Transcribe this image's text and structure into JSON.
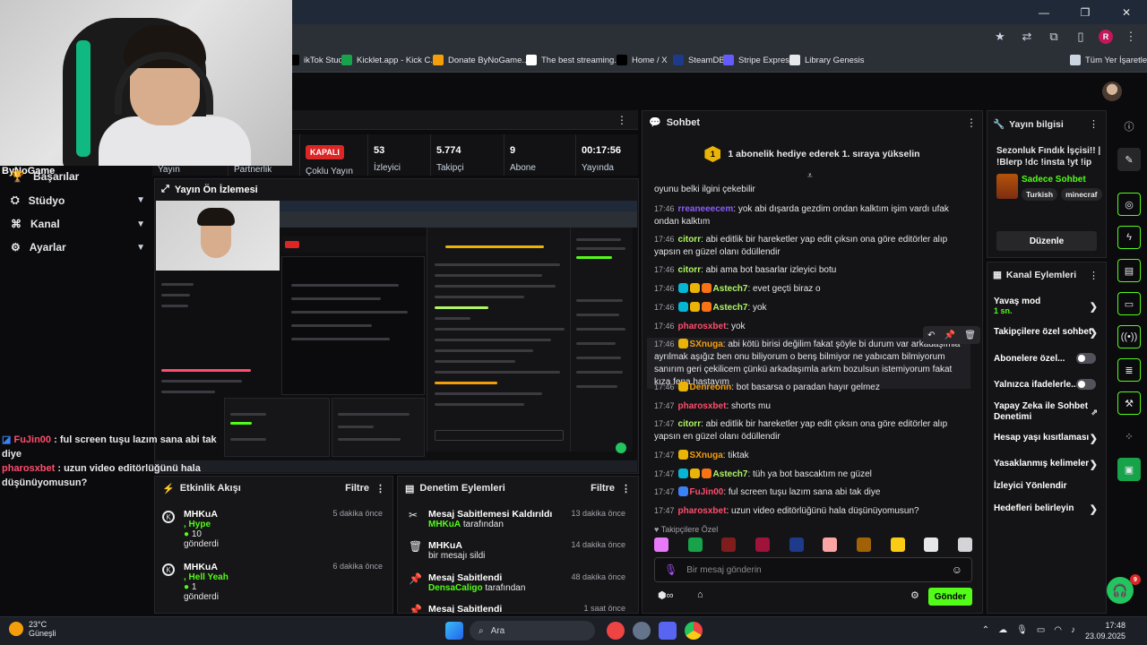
{
  "bookmarks": [
    {
      "label": "ikTok Studio",
      "color": "#000000"
    },
    {
      "label": "Kicklet.app - Kick C...",
      "color": "#16a34a"
    },
    {
      "label": "Donate ByNoGame...",
      "color": "#f59e0b"
    },
    {
      "label": "The best streaming...",
      "color": "#ffffff"
    },
    {
      "label": "Home / X",
      "color": "#000000"
    },
    {
      "label": "SteamDB",
      "color": "#1e3a8a"
    },
    {
      "label": "Stripe Express",
      "color": "#635bff"
    },
    {
      "label": "Library Genesis",
      "color": "#e5e7eb"
    },
    {
      "label": "Tüm Yer İşaretleri",
      "color": "#cbd5e1"
    }
  ],
  "profile_initial": "R",
  "overlay": {
    "brand": "ByNoGame",
    "nav": [
      {
        "label": "Başarılar",
        "icon": "trophy-icon"
      },
      {
        "label": "Stüdyo",
        "icon": "studio-icon"
      },
      {
        "label": "Kanal",
        "icon": "channel-icon"
      },
      {
        "label": "Ayarlar",
        "icon": "gear-icon"
      }
    ],
    "chat": [
      {
        "user": "FuJin00",
        "sep": " : ",
        "text": "ful screen tuşu lazım sana abi tak diye",
        "color": "#ff4d6d"
      },
      {
        "user": "pharosxbet",
        "sep": " : ",
        "text": "uzun video editörlüğünü hala düşünüyomusun?",
        "color": "#ff4d6d"
      }
    ]
  },
  "stats": {
    "status": "KAPALI",
    "left_labels": [
      "Yayın",
      "Partnerlik",
      "Çoklu Yayın"
    ],
    "items": [
      {
        "value": "53",
        "label": "İzleyici"
      },
      {
        "value": "5.774",
        "label": "Takipçi"
      },
      {
        "value": "9",
        "label": "Abone"
      },
      {
        "value": "00:17:56",
        "label": "Yayında"
      }
    ]
  },
  "preview": {
    "title": "Yayın Ön İzlemesi"
  },
  "activity": {
    "title": "Etkinlik Akışı",
    "filter": "Filtre",
    "items": [
      {
        "user": "MHKuA",
        "action": ", Hype",
        "amount": "10",
        "verb": "gönderdi",
        "time": "5 dakika önce"
      },
      {
        "user": "MHKuA",
        "action": ", Hell Yeah",
        "amount": "1",
        "verb": "gönderdi",
        "time": "6 dakika önce"
      }
    ]
  },
  "moderation": {
    "title": "Denetim Eylemleri",
    "filter": "Filtre",
    "items": [
      {
        "title": "Mesaj Sabitlemesi Kaldırıldı",
        "by": "MHKuA",
        "suffix": " tarafından",
        "time": "13 dakika önce",
        "icon": "unpin-icon"
      },
      {
        "title": "MHKuA",
        "by": "",
        "suffix": "bir mesajı sildi",
        "time": "14 dakika önce",
        "icon": "trash-icon"
      },
      {
        "title": "Mesaj Sabitlendi",
        "by": "DensaCaligo",
        "suffix": " tarafından",
        "time": "48 dakika önce",
        "icon": "pin-icon"
      },
      {
        "title": "Mesaj Sabitlendi",
        "by": "",
        "suffix": "",
        "time": "1 saat önce",
        "icon": "pin-icon"
      }
    ]
  },
  "chat": {
    "title": "Sohbet",
    "gift_count": "1",
    "gift_text": "1 abonelik hediye ederek 1. sıraya yükselin",
    "messages": [
      {
        "time": "",
        "user": "",
        "color": "#ffffff",
        "text": "oyunu belki ilgini çekebilir",
        "badges": []
      },
      {
        "time": "17:46",
        "user": "rreaneeecem",
        "color": "#8b5cf6",
        "text": "yok abi dışarda gezdim ondan kalktım işim vardı ufak ondan kalktım",
        "badges": []
      },
      {
        "time": "17:46",
        "user": "citorr",
        "color": "#b0f566",
        "text": "abi editlik bir hareketler yap edit çıksın ona göre editörler alıp yapsın en güzel olanı ödüllendir",
        "badges": []
      },
      {
        "time": "17:46",
        "user": "citorr",
        "color": "#b0f566",
        "text": "abi ama bot basarlar izleyici botu",
        "badges": []
      },
      {
        "time": "17:46",
        "user": "Astech7",
        "color": "#b0f566",
        "text": "evet geçti biraz o",
        "badges": [
          "#06b6d4",
          "#eab308",
          "#f97316"
        ]
      },
      {
        "time": "17:46",
        "user": "Astech7",
        "color": "#b0f566",
        "text": "yok",
        "badges": [
          "#06b6d4",
          "#eab308",
          "#f97316"
        ]
      },
      {
        "time": "17:46",
        "user": "pharosxbet",
        "color": "#ff4d6d",
        "text": "yok",
        "badges": []
      },
      {
        "time": "17:46",
        "user": "SXnuga",
        "color": "#f59e0b",
        "text": "abi kötü birisi değilim fakat şöyle bi durum var arkadaşımla ayrılmak aşığız ben onu biliyorum o benş bilmiyor ne yabıcam bilmiyorum sanırım geri çekilicem çünkü arkadaşımla arkm bozulsun istemiyorum fakat kıza fena hastayım",
        "badges": [
          "#eab308"
        ]
      },
      {
        "time": "17:46",
        "user": "Denreonn",
        "color": "#f59e0b",
        "text": "bot basarsa o paradan hayır gelmez",
        "badges": [
          "#eab308"
        ]
      },
      {
        "time": "17:47",
        "user": "pharosxbet",
        "color": "#ff4d6d",
        "text": "shorts mu",
        "badges": []
      },
      {
        "time": "17:47",
        "user": "citorr",
        "color": "#b0f566",
        "text": "abi editlik bir hareketler yap edit çıksın ona göre editörler alıp yapsın en güzel olanı ödüllendir",
        "badges": []
      },
      {
        "time": "17:47",
        "user": "SXnuga",
        "color": "#f59e0b",
        "text": "tiktak",
        "badges": [
          "#eab308"
        ]
      },
      {
        "time": "17:47",
        "user": "Astech7",
        "color": "#b0f566",
        "text": "tüh ya bot bascaktım ne güzel",
        "badges": [
          "#06b6d4",
          "#eab308",
          "#f97316"
        ]
      },
      {
        "time": "17:47",
        "user": "FuJin00",
        "color": "#ff4d6d",
        "text": "ful screen tuşu lazım sana abi tak diye",
        "badges": [
          "#3b82f6"
        ]
      },
      {
        "time": "17:47",
        "user": "pharosxbet",
        "color": "#ff4d6d",
        "text": "uzun video editörlüğünü hala düşünüyomusun?",
        "badges": []
      }
    ],
    "followers_label": "Takipçilere Özel",
    "input_placeholder": "Bir mesaj gönderin",
    "send_label": "Gönder",
    "emote_colors": [
      "#e879f9",
      "#16a34a",
      "#7f1d1d",
      "#9f1239",
      "#1e3a8a",
      "#fca5a5",
      "#a16207",
      "#facc15",
      "#e5e7eb",
      "#d4d4d8"
    ]
  },
  "stream_info": {
    "title": "Yayın bilgisi",
    "stream_title": "Sezonluk Fındık İşçisi!! | !Blerp !dc !insta !yt !ip",
    "chat_mode": "Sadece Sohbet",
    "tags": [
      "Turkish",
      "minecraf"
    ],
    "edit_label": "Düzenle"
  },
  "channel_actions": {
    "title": "Kanal Eylemleri",
    "items": [
      {
        "label": "Yavaş mod",
        "sub": "1 sn.",
        "kind": "chevron"
      },
      {
        "label": "Takipçilere özel sohbet",
        "sub": "",
        "kind": "chevron"
      },
      {
        "label": "Abonelere özel...",
        "sub": "",
        "kind": "toggle"
      },
      {
        "label": "Yalnızca ifadelerle...",
        "sub": "",
        "kind": "toggle"
      },
      {
        "label": "Yapay Zeka ile Sohbet Denetimi",
        "sub": "",
        "kind": "external"
      },
      {
        "label": "Hesap yaşı kısıtlaması",
        "sub": "",
        "kind": "chevron"
      },
      {
        "label": "Yasaklanmış kelimeler",
        "sub": "",
        "kind": "chevron"
      },
      {
        "label": "İzleyici Yönlendir",
        "sub": "",
        "kind": "none"
      },
      {
        "label": "Hedefleri belirleyin",
        "sub": "",
        "kind": "chevron"
      }
    ]
  },
  "help_badge": "9",
  "taskbar": {
    "temp": "23°C",
    "weather": "Güneşli",
    "search": "Ara",
    "time": "17:48",
    "date": "23.09.2025"
  }
}
